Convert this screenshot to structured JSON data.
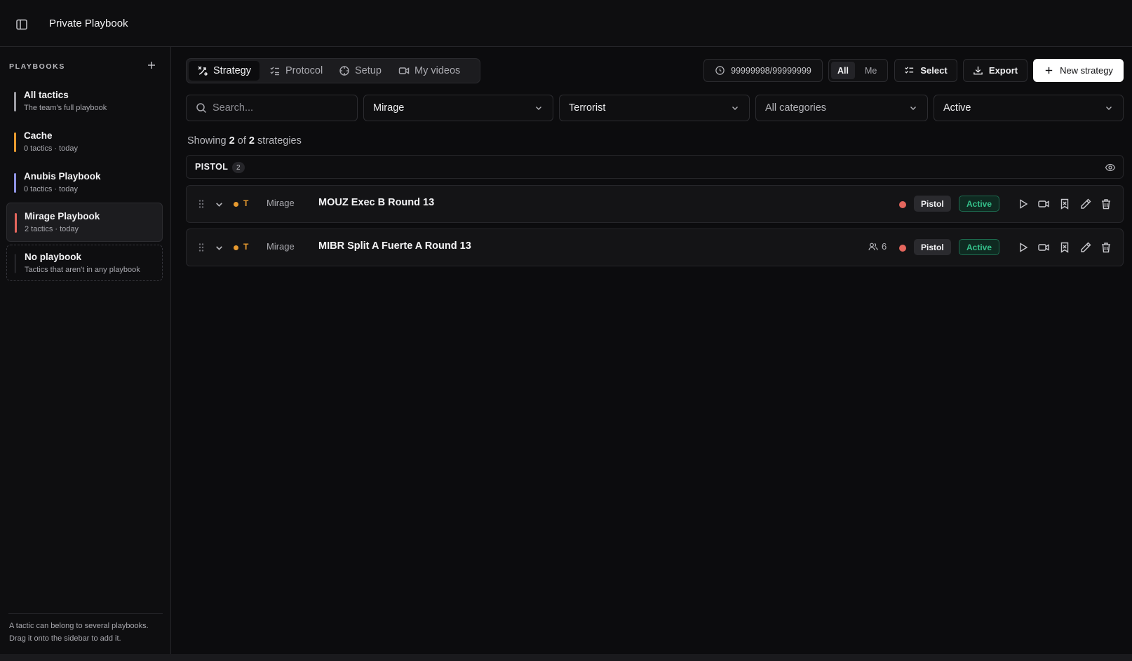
{
  "header": {
    "title": "Private Playbook"
  },
  "sidebar": {
    "heading": "PLAYBOOKS",
    "items": [
      {
        "name": "All tactics",
        "sub": "The team's full playbook",
        "color": "#9d9da3"
      },
      {
        "name": "Cache",
        "sub": "0 tactics · today",
        "color": "#e79a2f"
      },
      {
        "name": "Anubis Playbook",
        "sub": "0 tactics · today",
        "color": "#8e92e3"
      },
      {
        "name": "Mirage Playbook",
        "sub": "2 tactics · today",
        "color": "#e5665d"
      },
      {
        "name": "No playbook",
        "sub": "Tactics that aren't in any playbook",
        "color": ""
      }
    ],
    "footer": "A tactic can belong to several playbooks. Drag it onto the sidebar to add it."
  },
  "tabs": [
    {
      "label": "Strategy",
      "icon": "strategy-icon",
      "active": true
    },
    {
      "label": "Protocol",
      "icon": "checklist-icon",
      "active": false
    },
    {
      "label": "Setup",
      "icon": "crosshair-icon",
      "active": false
    },
    {
      "label": "My videos",
      "icon": "video-icon",
      "active": false
    }
  ],
  "toolbar": {
    "counter": "99999998/99999999",
    "filter_all": "All",
    "filter_me": "Me",
    "select_label": "Select",
    "export_label": "Export",
    "new_label": "New strategy"
  },
  "filters": {
    "search_placeholder": "Search...",
    "map": "Mirage",
    "side": "Terrorist",
    "category": "All categories",
    "status": "Active"
  },
  "summary": {
    "prefix": "Showing",
    "shown": "2",
    "of": "of",
    "total": "2",
    "suffix": "strategies"
  },
  "group": {
    "name": "PISTOL",
    "count": "2"
  },
  "strategies": [
    {
      "side": "T",
      "map": "Mirage",
      "name": "MOUZ Exec B Round 13",
      "players": "",
      "type": "Pistol",
      "status": "Active"
    },
    {
      "side": "T",
      "map": "Mirage",
      "name": "MIBR Split A Fuerte A Round 13",
      "players": "6",
      "type": "Pistol",
      "status": "Active"
    }
  ],
  "colors": {
    "t_side": "#e79a2f",
    "round_dot": "#e5665d",
    "status_green": "#34c08a"
  }
}
